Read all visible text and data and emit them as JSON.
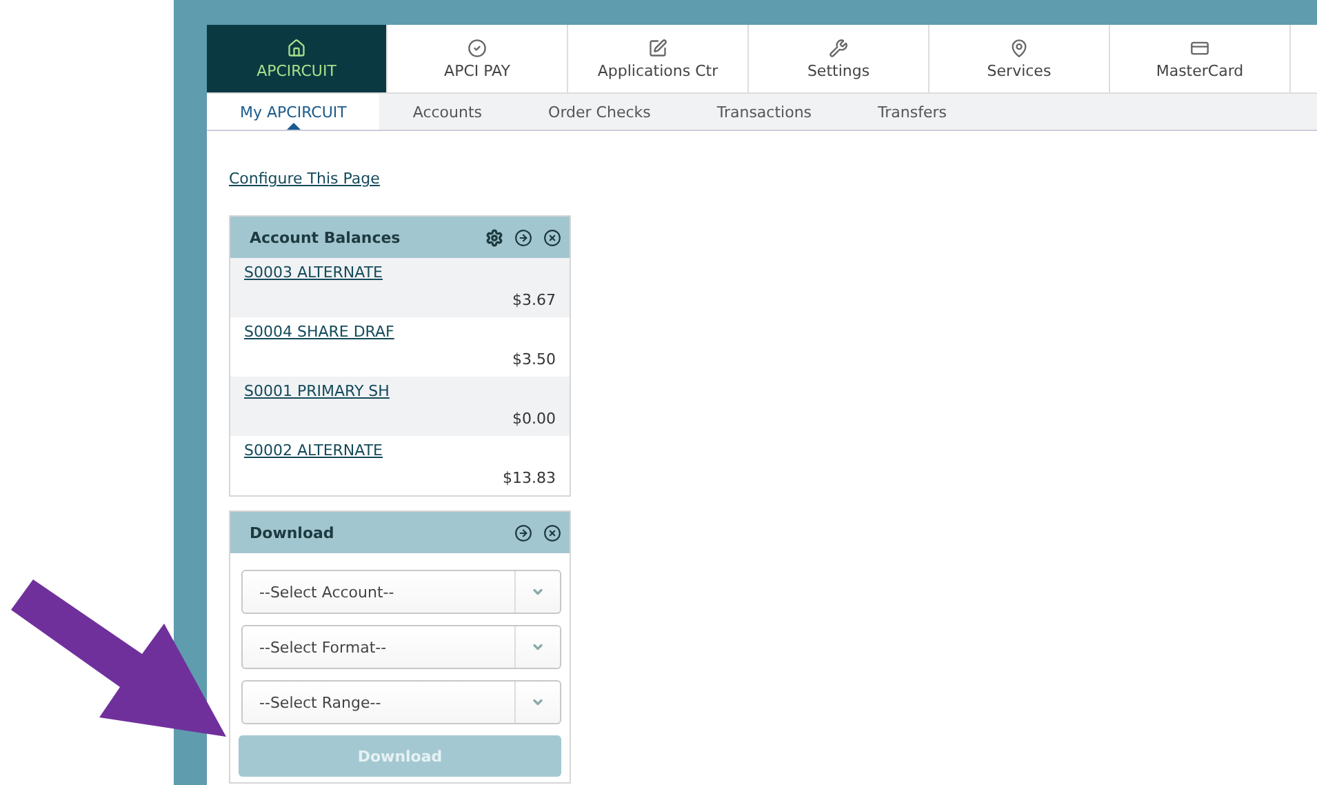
{
  "nav_tabs": [
    {
      "label": "APCIRCUIT",
      "selected": true
    },
    {
      "label": "APCI PAY",
      "selected": false
    },
    {
      "label": "Applications Ctr",
      "selected": false
    },
    {
      "label": "Settings",
      "selected": false
    },
    {
      "label": "Services",
      "selected": false
    },
    {
      "label": "MasterCard",
      "selected": false
    }
  ],
  "sub_tabs": [
    {
      "label": "My APCIRCUIT",
      "selected": true
    },
    {
      "label": "Accounts",
      "selected": false
    },
    {
      "label": "Order Checks",
      "selected": false
    },
    {
      "label": "Transactions",
      "selected": false
    },
    {
      "label": "Transfers",
      "selected": false
    }
  ],
  "configure_link": "Configure This Page",
  "account_balances": {
    "title": "Account Balances",
    "accounts": [
      {
        "name": "S0003 ALTERNATE",
        "balance": "$3.67"
      },
      {
        "name": "S0004 SHARE DRAF",
        "balance": "$3.50"
      },
      {
        "name": "S0001 PRIMARY SH",
        "balance": "$0.00"
      },
      {
        "name": "S0002 ALTERNATE",
        "balance": "$13.83"
      }
    ]
  },
  "download": {
    "title": "Download",
    "selects": [
      {
        "placeholder": "--Select Account--"
      },
      {
        "placeholder": "--Select Format--"
      },
      {
        "placeholder": "--Select Range--"
      }
    ],
    "button": {
      "label": "Download",
      "disabled": true
    }
  }
}
